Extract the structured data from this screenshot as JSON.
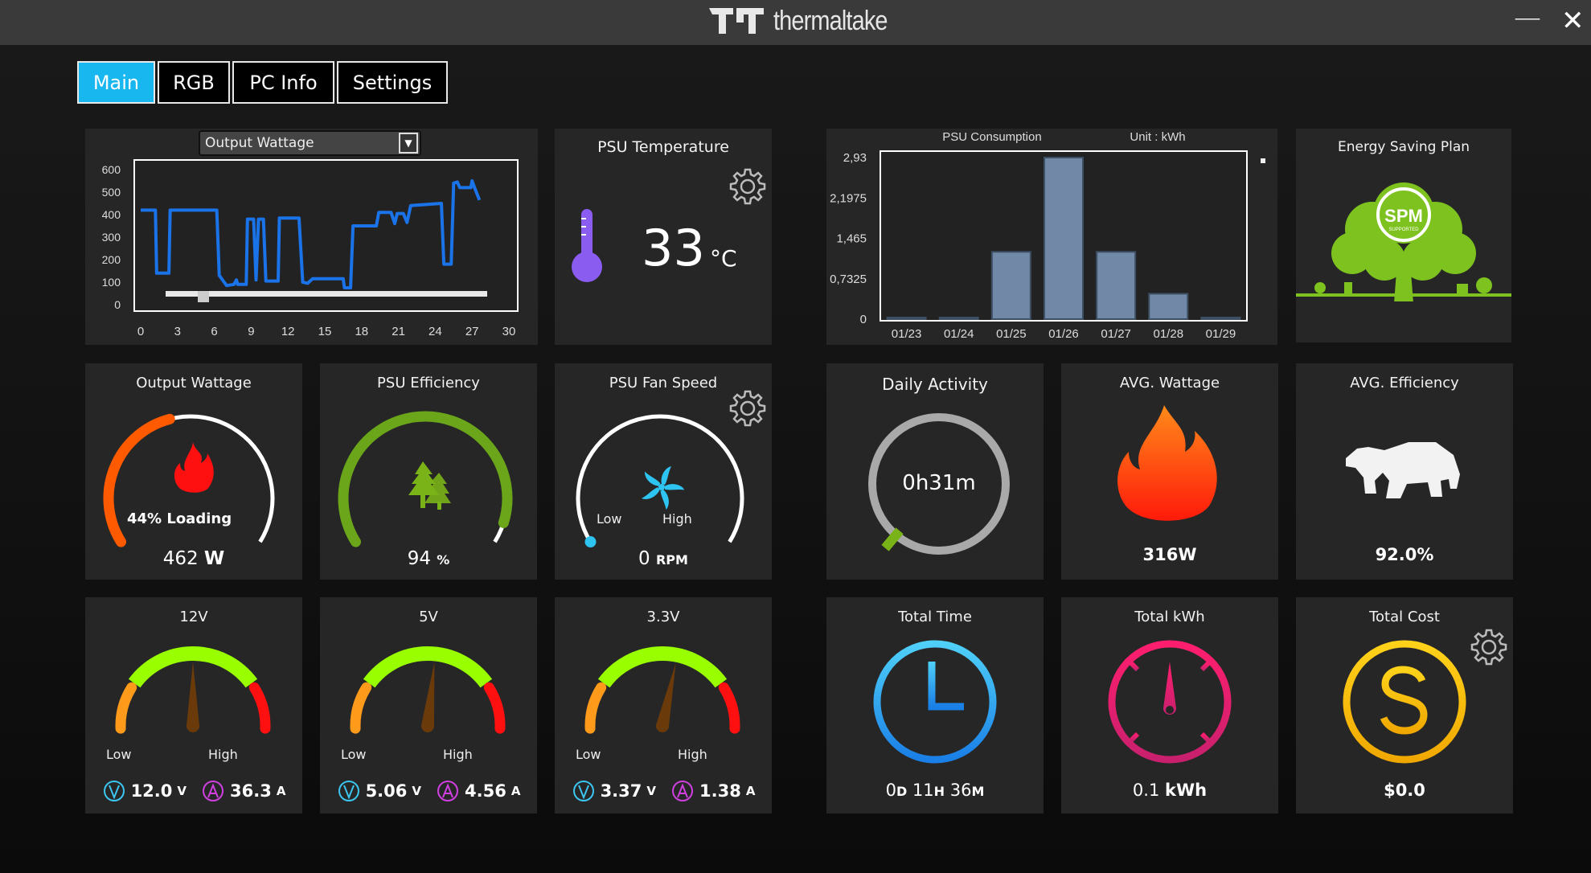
{
  "app": {
    "brand": "thermaltake",
    "minimize": "—",
    "close": "✕"
  },
  "tabs": [
    {
      "label": "Main",
      "active": true
    },
    {
      "label": "RGB"
    },
    {
      "label": "PC Info"
    },
    {
      "label": "Settings"
    }
  ],
  "history": {
    "dropdown_value": "Output Wattage"
  },
  "chart_data": [
    {
      "type": "line",
      "title": "",
      "xlabel": "",
      "ylabel": "",
      "xlim": [
        0,
        30
      ],
      "ylim": [
        0,
        600
      ],
      "x_ticks": [
        "0",
        "3",
        "6",
        "9",
        "12",
        "15",
        "18",
        "21",
        "24",
        "27",
        "30"
      ],
      "y_ticks": [
        "600",
        "500",
        "400",
        "300",
        "200",
        "100",
        "0"
      ],
      "color": "#1a73e8",
      "scroll_position": 0.1,
      "points": [
        [
          0,
          420
        ],
        [
          1.2,
          420
        ],
        [
          1.3,
          140
        ],
        [
          2.3,
          140
        ],
        [
          2.4,
          420
        ],
        [
          6.2,
          420
        ],
        [
          6.4,
          130
        ],
        [
          6.8,
          100
        ],
        [
          7,
          85
        ],
        [
          7.6,
          90
        ],
        [
          7.8,
          110
        ],
        [
          7.9,
          90
        ],
        [
          8.6,
          90
        ],
        [
          8.7,
          380
        ],
        [
          9.2,
          380
        ],
        [
          9.4,
          110
        ],
        [
          9.6,
          380
        ],
        [
          10,
          380
        ],
        [
          10.2,
          105
        ],
        [
          11.2,
          105
        ],
        [
          11.3,
          385
        ],
        [
          12.9,
          385
        ],
        [
          13.2,
          100
        ],
        [
          13.6,
          95
        ],
        [
          14,
          115
        ],
        [
          16.5,
          115
        ],
        [
          16.6,
          75
        ],
        [
          17.1,
          75
        ],
        [
          17.3,
          350
        ],
        [
          19.2,
          350
        ],
        [
          19.4,
          410
        ],
        [
          20.4,
          410
        ],
        [
          20.7,
          360
        ],
        [
          20.9,
          405
        ],
        [
          21.4,
          405
        ],
        [
          21.7,
          365
        ],
        [
          22,
          440
        ],
        [
          24.5,
          450
        ],
        [
          24.7,
          180
        ],
        [
          25.3,
          180
        ],
        [
          25.5,
          540
        ],
        [
          25.8,
          545
        ],
        [
          26,
          520
        ],
        [
          26.9,
          520
        ],
        [
          27,
          550
        ],
        [
          27.2,
          520
        ],
        [
          27.6,
          465
        ]
      ]
    },
    {
      "type": "bar",
      "title": "PSU Consumption",
      "unit": "Unit : kWh",
      "ylim": [
        0,
        2.93
      ],
      "y_ticks": [
        "2,93",
        "2,1975",
        "1,465",
        "0,7325",
        "0"
      ],
      "categories": [
        "01/23",
        "01/24",
        "01/25",
        "01/26",
        "01/27",
        "01/28",
        "01/29"
      ],
      "values": [
        0,
        0,
        1.22,
        2.93,
        1.22,
        0.46,
        0
      ],
      "color": "#7189a6"
    }
  ],
  "temperature": {
    "title": "PSU Temperature",
    "value": "33",
    "unit": "°C"
  },
  "energy": {
    "title": "Energy Saving Plan",
    "logo_text": "SPM",
    "logo_sub": "SUPPORTED"
  },
  "output_wattage": {
    "title": "Output Wattage",
    "loading": "44% Loading",
    "value": "462",
    "unit": "W",
    "level": 0.44
  },
  "efficiency": {
    "title": "PSU Efficiency",
    "value": "94",
    "unit": "%",
    "level": 0.94
  },
  "fan": {
    "title": "PSU Fan Speed",
    "low": "Low",
    "high": "High",
    "value": "0",
    "unit": "RPM",
    "level": 0
  },
  "daily": {
    "title": "Daily Activity",
    "value": "0h31m"
  },
  "avg_wattage": {
    "title": "AVG. Wattage",
    "value": "316W"
  },
  "avg_eff": {
    "title": "AVG. Efficiency",
    "value": "92.0%"
  },
  "rails": [
    {
      "title": "12V",
      "low": "Low",
      "high": "High",
      "volt": "12.0",
      "volt_unit": "V",
      "amp": "36.3",
      "amp_unit": "A",
      "needle_level": 0.5
    },
    {
      "title": "5V",
      "low": "Low",
      "high": "High",
      "volt": "5.06",
      "volt_unit": "V",
      "amp": "4.56",
      "amp_unit": "A",
      "needle_level": 0.56
    },
    {
      "title": "3.3V",
      "low": "Low",
      "high": "High",
      "volt": "3.37",
      "volt_unit": "V",
      "amp": "1.38",
      "amp_unit": "A",
      "needle_level": 0.62
    }
  ],
  "total_time": {
    "title": "Total Time",
    "d": "0",
    "d_unit": "D",
    "h": "11",
    "h_unit": "H",
    "m": "36",
    "m_unit": "M"
  },
  "total_kwh": {
    "title": "Total kWh",
    "value": "0.1",
    "unit": "kWh"
  },
  "total_cost": {
    "title": "Total Cost",
    "value": "$0.0"
  },
  "colors": {
    "accent": "#19b7f0",
    "orange": "#ff5a00",
    "green": "#7ab317",
    "red": "#ff1010",
    "lime": "#99ff00",
    "cyan": "#3bc5f0",
    "magenta": "#d040e0"
  }
}
